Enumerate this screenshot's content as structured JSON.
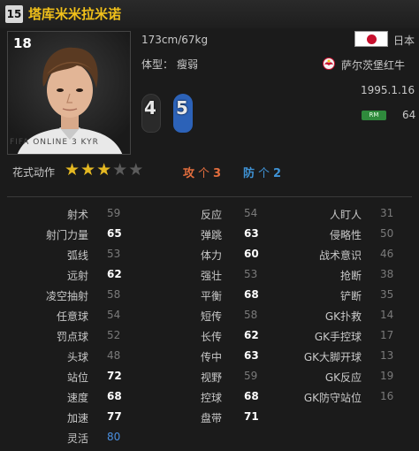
{
  "header": {
    "season_badge": "15",
    "player_name": "塔库米米拉米诺"
  },
  "photo": {
    "shirt_number": "18",
    "watermark": "FIFA ONLINE 3 KYR"
  },
  "profile": {
    "height_weight": "173cm/67kg",
    "body_type_label": "体型：",
    "body_type_value": "瘦弱",
    "nation": "日本",
    "club": "萨尔茨堡红牛",
    "birthdate": "1995.1.16",
    "position": "RM",
    "position_rating": "64",
    "weak_foot": "4",
    "strong_foot": "5"
  },
  "skills": {
    "label": "花式动作",
    "stars_total": 5,
    "stars_filled": 3
  },
  "work_rate": {
    "attack_label": "攻",
    "attack_arrow": "个",
    "attack_value": "3",
    "defense_label": "防",
    "defense_arrow": "个",
    "defense_value": "2"
  },
  "stats": {
    "col1": [
      {
        "name": "射术",
        "value": "59",
        "tone": "lo"
      },
      {
        "name": "射门力量",
        "value": "65",
        "tone": "hi"
      },
      {
        "name": "弧线",
        "value": "53",
        "tone": "lo"
      },
      {
        "name": "远射",
        "value": "62",
        "tone": "hi"
      },
      {
        "name": "凌空抽射",
        "value": "58",
        "tone": "lo"
      },
      {
        "name": "任意球",
        "value": "54",
        "tone": "lo"
      },
      {
        "name": "罚点球",
        "value": "52",
        "tone": "lo"
      },
      {
        "name": "头球",
        "value": "48",
        "tone": "lo"
      },
      {
        "name": "站位",
        "value": "72",
        "tone": "hi"
      },
      {
        "name": "速度",
        "value": "68",
        "tone": "hi"
      },
      {
        "name": "加速",
        "value": "77",
        "tone": "hi"
      },
      {
        "name": "灵活",
        "value": "80",
        "tone": "blue"
      }
    ],
    "col2": [
      {
        "name": "反应",
        "value": "54",
        "tone": "lo"
      },
      {
        "name": "弹跳",
        "value": "63",
        "tone": "hi"
      },
      {
        "name": "体力",
        "value": "60",
        "tone": "hi"
      },
      {
        "name": "强壮",
        "value": "53",
        "tone": "lo"
      },
      {
        "name": "平衡",
        "value": "68",
        "tone": "hi"
      },
      {
        "name": "短传",
        "value": "58",
        "tone": "lo"
      },
      {
        "name": "长传",
        "value": "62",
        "tone": "hi"
      },
      {
        "name": "传中",
        "value": "63",
        "tone": "hi"
      },
      {
        "name": "视野",
        "value": "59",
        "tone": "lo"
      },
      {
        "name": "控球",
        "value": "68",
        "tone": "hi"
      },
      {
        "name": "盘带",
        "value": "71",
        "tone": "hi"
      }
    ],
    "col3": [
      {
        "name": "人盯人",
        "value": "31",
        "tone": "lo"
      },
      {
        "name": "侵略性",
        "value": "50",
        "tone": "lo"
      },
      {
        "name": "战术意识",
        "value": "46",
        "tone": "lo"
      },
      {
        "name": "抢断",
        "value": "38",
        "tone": "lo"
      },
      {
        "name": "铲断",
        "value": "35",
        "tone": "lo"
      },
      {
        "name": "GK扑救",
        "value": "14",
        "tone": "lo"
      },
      {
        "name": "GK手控球",
        "value": "17",
        "tone": "lo"
      },
      {
        "name": "GK大脚开球",
        "value": "13",
        "tone": "lo"
      },
      {
        "name": "GK反应",
        "value": "19",
        "tone": "lo"
      },
      {
        "name": "GK防守站位",
        "value": "16",
        "tone": "lo"
      }
    ]
  },
  "colors": {
    "name": "#f2c11a",
    "attack": "#e26d3d",
    "defense": "#3f93d6",
    "star_on": "#e4b822",
    "star_off": "#5b5b5b",
    "position_badge": "#2f8a3c",
    "strong_foot": "#2c62b8"
  }
}
